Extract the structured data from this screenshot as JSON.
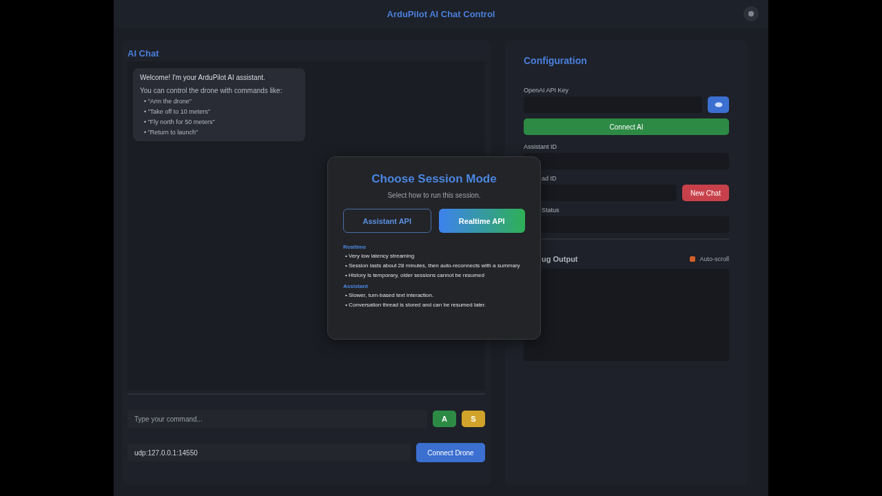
{
  "header": {
    "title": "ArduPilot AI Chat Control"
  },
  "chat": {
    "title": "AI Chat",
    "welcome": {
      "greeting": "Welcome! I'm your ArduPilot AI assistant.",
      "intro": "You can control the drone with commands like:",
      "examples": [
        "• \"Arm the drone\"",
        "• \"Take off to 10 meters\"",
        "• \"Fly north for 50 meters\"",
        "• \"Return to launch\""
      ]
    },
    "command_input": {
      "placeholder": "Type your command..."
    },
    "buttons": [
      {
        "label": "A",
        "kind": "green"
      },
      {
        "label": "S",
        "kind": "yellow"
      }
    ],
    "connection": {
      "value": "udp:127.0.0.1:14550",
      "button": "Connect Drone"
    }
  },
  "config": {
    "title": "Configuration",
    "fields": [
      {
        "label": "OpenAI API Key",
        "kind": "key",
        "partial": false,
        "action": "Connect AI"
      },
      {
        "label": "Assistant ID",
        "kind": "plain",
        "partial": false
      },
      {
        "label": "ad ID",
        "kind": "thread",
        "partial": true,
        "action": "New Chat"
      },
      {
        "label": "Status",
        "kind": "plain",
        "partial": true
      }
    ],
    "debug": {
      "title": "ug Output",
      "partial": true,
      "autoscroll": {
        "label": "Auto-scroll",
        "checked": true
      }
    }
  },
  "modal": {
    "title": "Choose Session Mode",
    "subtitle": "Select how to run this session.",
    "options": [
      {
        "label": "Assistant API",
        "selected": false
      },
      {
        "label": "Realtime API",
        "selected": true
      }
    ],
    "sections": [
      {
        "heading": "Realtime",
        "points": [
          "• Very low latency streaming",
          "• Session lasts about 28 minutes, then auto-reconnects with a summary",
          "• History is temporary, older sessions cannot be resumed"
        ]
      },
      {
        "heading": "Assistant",
        "points": [
          "• Slower, turn-based text interaction.",
          "• Conversation thread is stored and can be resumed later."
        ]
      }
    ]
  }
}
